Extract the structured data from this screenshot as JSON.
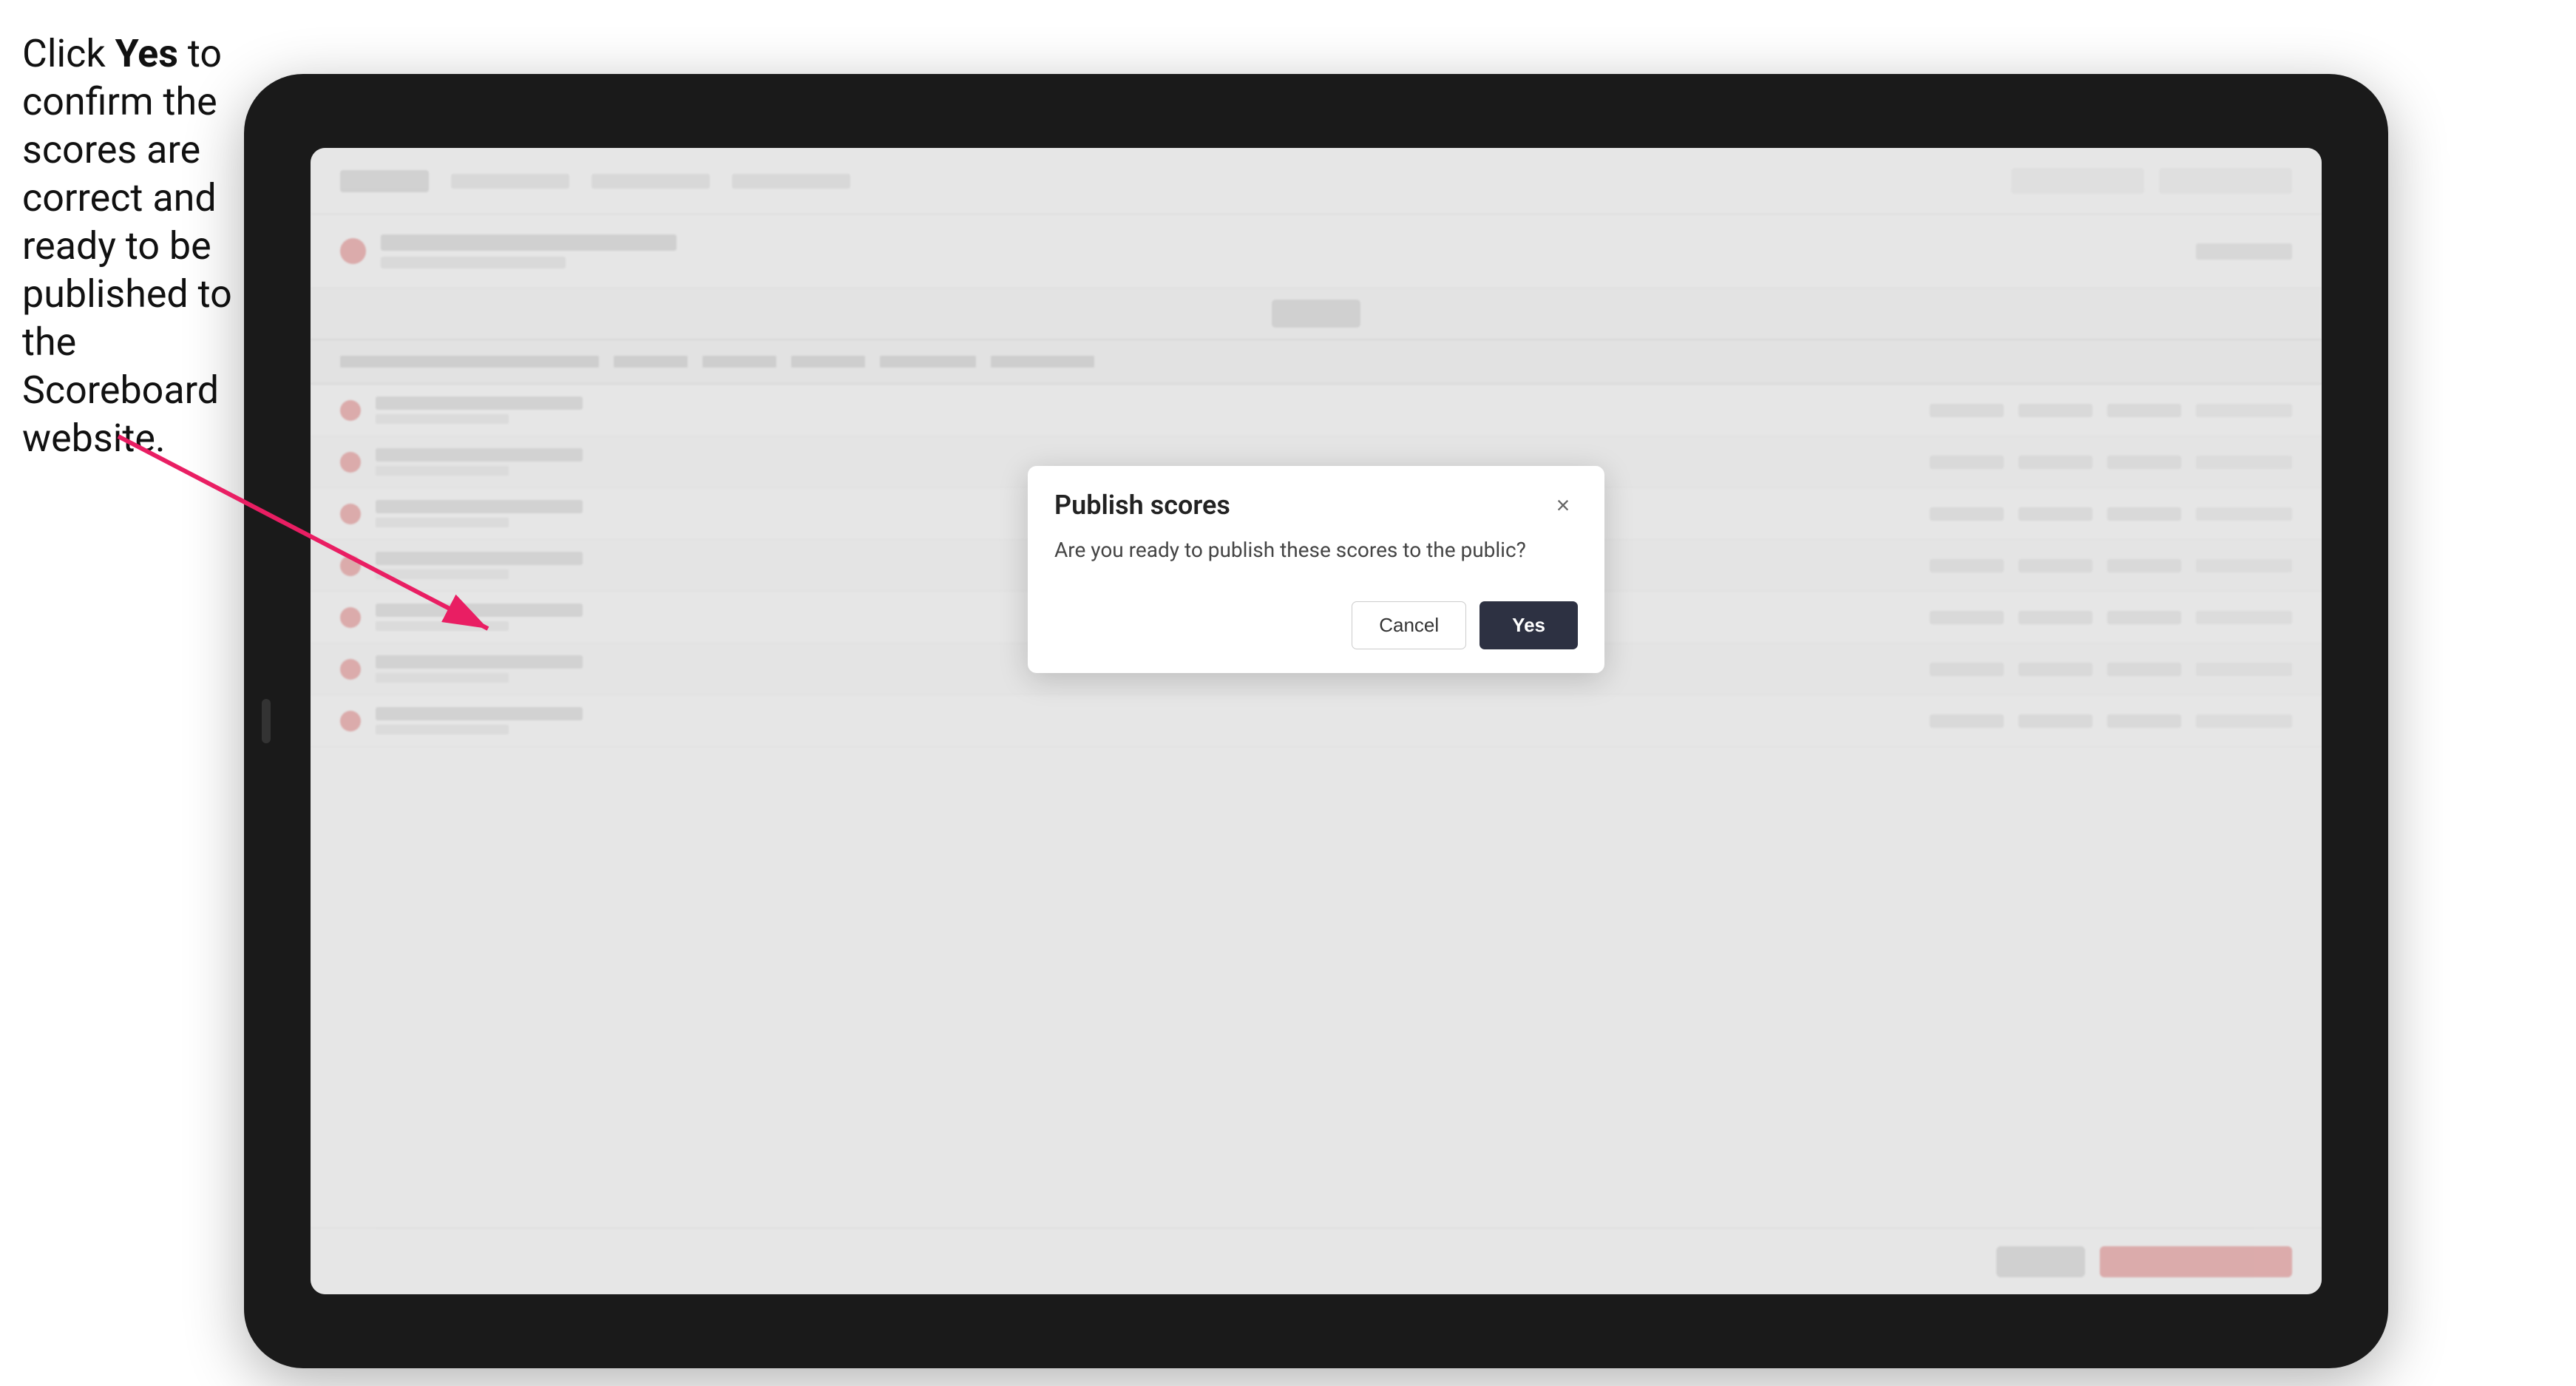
{
  "instruction": {
    "text_parts": [
      "Click ",
      "Yes",
      " to confirm the scores are correct and ready to be published to the Scoreboard website."
    ]
  },
  "tablet": {
    "nav": {
      "logo_alt": "App Logo"
    },
    "dialog": {
      "title": "Publish scores",
      "message": "Are you ready to publish these scores to the public?",
      "cancel_label": "Cancel",
      "yes_label": "Yes",
      "close_icon": "×"
    },
    "table": {
      "rows": [
        {
          "id": 1
        },
        {
          "id": 2
        },
        {
          "id": 3
        },
        {
          "id": 4
        },
        {
          "id": 5
        },
        {
          "id": 6
        },
        {
          "id": 7
        }
      ]
    }
  },
  "colors": {
    "badge_red": "#e57373",
    "dialog_bg": "#ffffff",
    "btn_yes_bg": "#2d3142",
    "btn_yes_text": "#ffffff",
    "btn_cancel_border": "#cccccc"
  }
}
